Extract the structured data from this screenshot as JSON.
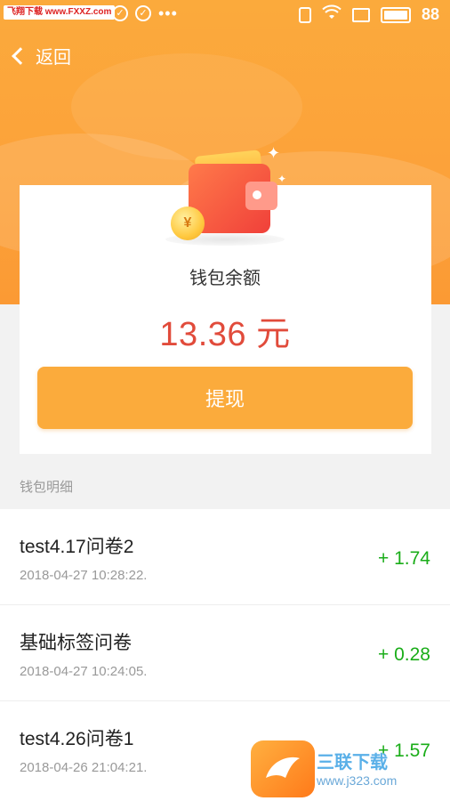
{
  "status_bar": {
    "watermark": "飞翔下载 www.FXXZ.com",
    "battery_level": "88"
  },
  "nav": {
    "back_label": "返回"
  },
  "wallet": {
    "balance_title": "钱包余额",
    "balance_amount": "13.36 元",
    "withdraw_label": "提现",
    "coin_symbol": "¥"
  },
  "details": {
    "section_title": "钱包明细",
    "items": [
      {
        "title": "test4.17问卷2",
        "time": "2018-04-27 10:28:22.",
        "amount": "+ 1.74"
      },
      {
        "title": "基础标签问卷",
        "time": "2018-04-27 10:24:05.",
        "amount": "+ 0.28"
      },
      {
        "title": "test4.26问卷1",
        "time": "2018-04-26 21:04:21.",
        "amount": "+ 1.57"
      }
    ]
  },
  "watermark_logo": {
    "name": "三联下载",
    "url": "www.j323.com"
  },
  "colors": {
    "header_orange": "#fbaa3c",
    "amount_red": "#e14b3b",
    "button_orange": "#fbab3c",
    "income_green": "#1aad19"
  }
}
